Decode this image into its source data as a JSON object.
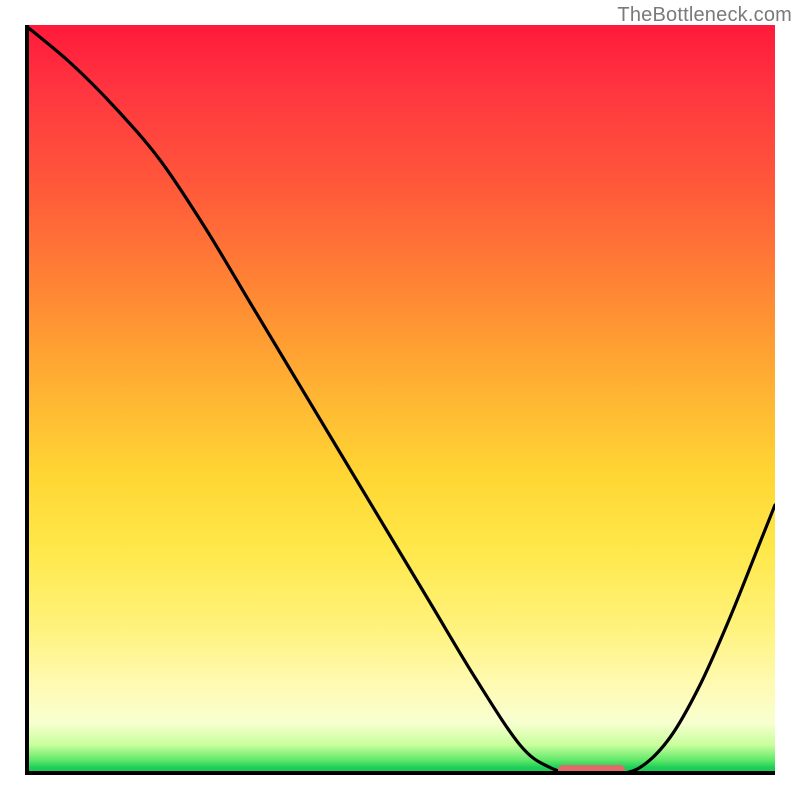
{
  "watermark": "TheBottleneck.com",
  "chart_data": {
    "type": "line",
    "title": "",
    "xlabel": "",
    "ylabel": "",
    "xlim": [
      0,
      100
    ],
    "ylim": [
      0,
      100
    ],
    "x": [
      0,
      6,
      12,
      18,
      24,
      30,
      36,
      42,
      48,
      54,
      60,
      66,
      70,
      74,
      78,
      82,
      86,
      90,
      94,
      98,
      100
    ],
    "values": [
      100,
      95,
      89,
      82,
      73,
      63,
      53,
      43,
      33,
      23,
      13,
      4,
      1,
      0,
      0,
      1,
      5,
      12,
      21,
      31,
      36
    ],
    "optimum_range_x": [
      71,
      80
    ],
    "gradient_stops": [
      {
        "pos": 0,
        "color": "#ff1a3a"
      },
      {
        "pos": 50,
        "color": "#ffb733"
      },
      {
        "pos": 88,
        "color": "#fffab3"
      },
      {
        "pos": 100,
        "color": "#18c94e"
      }
    ],
    "marker_color": "#e26a6a"
  }
}
